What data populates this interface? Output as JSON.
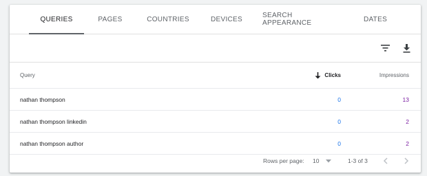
{
  "tabs": [
    {
      "label": "QUERIES",
      "active": true
    },
    {
      "label": "PAGES",
      "active": false
    },
    {
      "label": "COUNTRIES",
      "active": false
    },
    {
      "label": "DEVICES",
      "active": false
    },
    {
      "label": "SEARCH APPEARANCE",
      "active": false
    },
    {
      "label": "DATES",
      "active": false
    }
  ],
  "toolbar": {
    "filter_icon": "filter-icon",
    "download_icon": "download-icon"
  },
  "table": {
    "headers": {
      "query": "Query",
      "clicks": "Clicks",
      "impressions": "Impressions"
    },
    "sort_icon": "arrow-down-icon",
    "rows": [
      {
        "query": "nathan thompson",
        "clicks": "0",
        "impressions": "13"
      },
      {
        "query": "nathan thompson linkedin",
        "clicks": "0",
        "impressions": "2"
      },
      {
        "query": "nathan thompson author",
        "clicks": "0",
        "impressions": "2"
      }
    ]
  },
  "footer": {
    "rows_per_page_label": "Rows per page:",
    "rows_per_page_value": "10",
    "range": "1-3 of 3"
  },
  "colors": {
    "clicks": "#1a73e8",
    "impressions": "#7b1fa2"
  }
}
